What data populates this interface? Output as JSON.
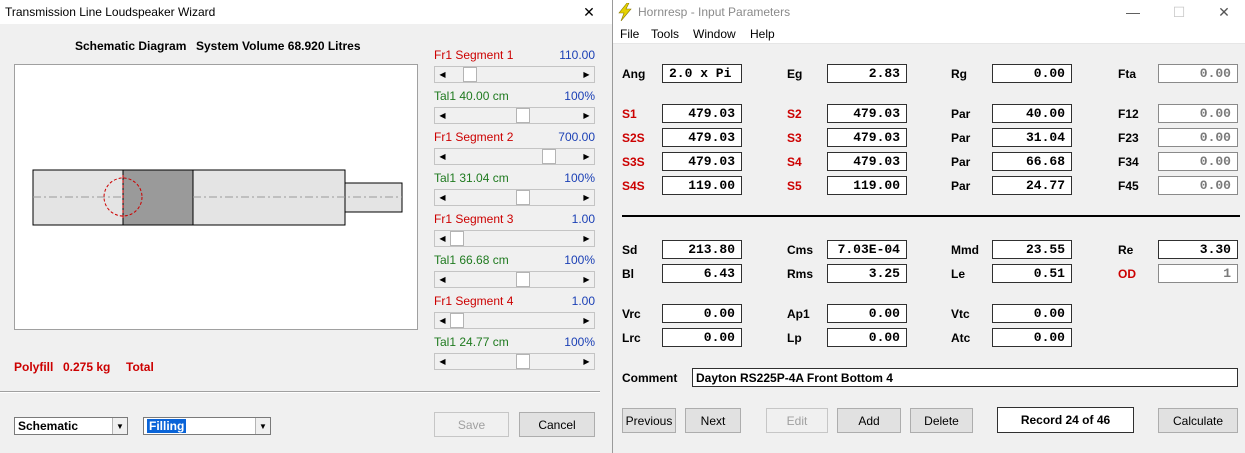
{
  "wizard": {
    "title": "Transmission Line Loudspeaker Wizard",
    "close_glyph": "✕",
    "schematic_label": "Schematic Diagram",
    "system_volume": "System Volume 68.920 Litres",
    "segments": [
      {
        "fr_label": "Fr1  Segment 1",
        "fr_value": "110.00",
        "tal_label": "Tal1  40.00 cm",
        "tal_value": "100%",
        "fr_fill": 0.1,
        "tal_fill": 0.5
      },
      {
        "fr_label": "Fr1  Segment 2",
        "fr_value": "700.00",
        "tal_label": "Tal1  31.04 cm",
        "tal_value": "100%",
        "fr_fill": 0.7,
        "tal_fill": 0.5
      },
      {
        "fr_label": "Fr1  Segment 3",
        "fr_value": "1.00",
        "tal_label": "Tal1  66.68 cm",
        "tal_value": "100%",
        "fr_fill": 0.0,
        "tal_fill": 0.5
      },
      {
        "fr_label": "Fr1  Segment 4",
        "fr_value": "1.00",
        "tal_label": "Tal1  24.77 cm",
        "tal_value": "100%",
        "fr_fill": 0.0,
        "tal_fill": 0.5
      }
    ],
    "polyfill_label": "Polyfill",
    "polyfill_value": "0.275 kg",
    "polyfill_total": "Total",
    "view_select": "Schematic",
    "fill_select": "Filling",
    "save_label": "Save",
    "cancel_label": "Cancel"
  },
  "hornresp": {
    "title": "Hornresp - Input Parameters",
    "menu": [
      "File",
      "Tools",
      "Window",
      "Help"
    ],
    "minimize_glyph": "—",
    "maximize_glyph": "☐",
    "close_glyph": "✕",
    "rows": {
      "r1": [
        {
          "label": "Ang",
          "value": "2.0 x Pi",
          "red": false
        },
        {
          "label": "Eg",
          "value": "2.83",
          "red": false
        },
        {
          "label": "Rg",
          "value": "0.00",
          "red": false
        },
        {
          "label": "Fta",
          "value": "0.00",
          "red": false
        }
      ],
      "r2": [
        {
          "label": "S1",
          "value": "479.03",
          "red": true
        },
        {
          "label": "S2",
          "value": "479.03",
          "red": true
        },
        {
          "label": "Par",
          "value": "40.00",
          "red": false
        },
        {
          "label": "F12",
          "value": "0.00",
          "red": false
        }
      ],
      "r3": [
        {
          "label": "S2S",
          "value": "479.03",
          "red": true
        },
        {
          "label": "S3",
          "value": "479.03",
          "red": true
        },
        {
          "label": "Par",
          "value": "31.04",
          "red": false
        },
        {
          "label": "F23",
          "value": "0.00",
          "red": false
        }
      ],
      "r4": [
        {
          "label": "S3S",
          "value": "479.03",
          "red": true
        },
        {
          "label": "S4",
          "value": "479.03",
          "red": true
        },
        {
          "label": "Par",
          "value": "66.68",
          "red": false
        },
        {
          "label": "F34",
          "value": "0.00",
          "red": false
        }
      ],
      "r5": [
        {
          "label": "S4S",
          "value": "119.00",
          "red": true
        },
        {
          "label": "S5",
          "value": "119.00",
          "red": true
        },
        {
          "label": "Par",
          "value": "24.77",
          "red": false
        },
        {
          "label": "F45",
          "value": "0.00",
          "red": false
        }
      ],
      "r6": [
        {
          "label": "Sd",
          "value": "213.80",
          "red": false
        },
        {
          "label": "Cms",
          "value": "7.03E-04",
          "red": false
        },
        {
          "label": "Mmd",
          "value": "23.55",
          "red": false
        },
        {
          "label": "Re",
          "value": "3.30",
          "red": false
        }
      ],
      "r7": [
        {
          "label": "Bl",
          "value": "6.43",
          "red": false
        },
        {
          "label": "Rms",
          "value": "3.25",
          "red": false
        },
        {
          "label": "Le",
          "value": "0.51",
          "red": false
        },
        {
          "label": "OD",
          "value": "1",
          "red": true
        }
      ],
      "r8": [
        {
          "label": "Vrc",
          "value": "0.00",
          "red": false
        },
        {
          "label": "Ap1",
          "value": "0.00",
          "red": false
        },
        {
          "label": "Vtc",
          "value": "0.00",
          "red": false
        }
      ],
      "r9": [
        {
          "label": "Lrc",
          "value": "0.00",
          "red": false
        },
        {
          "label": "Lp",
          "value": "0.00",
          "red": false
        },
        {
          "label": "Atc",
          "value": "0.00",
          "red": false
        }
      ]
    },
    "comment_label": "Comment",
    "comment_value": "Dayton RS225P-4A Front Bottom 4",
    "buttons": {
      "previous": "Previous",
      "next": "Next",
      "edit": "Edit",
      "add": "Add",
      "delete": "Delete",
      "record": "Record 24 of 46",
      "calculate": "Calculate"
    }
  },
  "colors": {
    "red": "#cc0000",
    "green": "#1f7a1f",
    "blue": "#1a3fb5",
    "select_highlight": "#0a64d8",
    "duct_light": "#e4e4e4",
    "duct_dark": "#9a9a9a"
  },
  "icons": {
    "app": "lightning-bolt-icon"
  }
}
